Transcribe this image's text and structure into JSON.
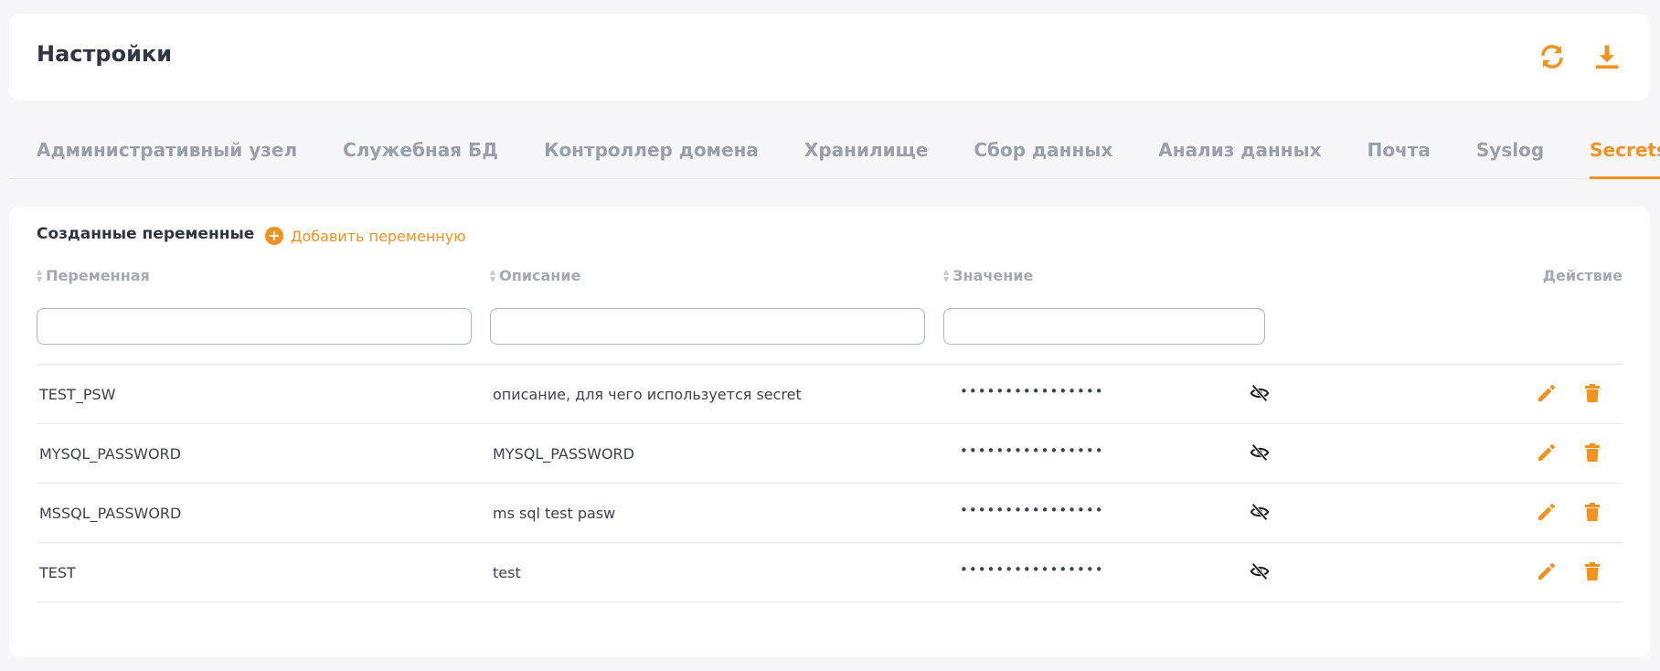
{
  "header": {
    "title": "Настройки",
    "refresh_icon": "refresh-icon",
    "download_icon": "download-icon",
    "accent_color": "#f29220"
  },
  "tabs": [
    {
      "label": "Административный узел",
      "active": false
    },
    {
      "label": "Служебная БД",
      "active": false
    },
    {
      "label": "Контроллер домена",
      "active": false
    },
    {
      "label": "Хранилище",
      "active": false
    },
    {
      "label": "Сбор данных",
      "active": false
    },
    {
      "label": "Анализ данных",
      "active": false
    },
    {
      "label": "Почта",
      "active": false
    },
    {
      "label": "Syslog",
      "active": false
    },
    {
      "label": "Secrets",
      "active": true
    }
  ],
  "section": {
    "title": "Созданные переменные",
    "add_label": "Добавить переменную"
  },
  "columns": {
    "variable": "Переменная",
    "description": "Описание",
    "value": "Значение",
    "action": "Действие"
  },
  "filters": {
    "variable": "",
    "description": "",
    "value": ""
  },
  "rows": [
    {
      "variable": "TEST_PSW",
      "description": "описание, для чего используется secret",
      "value": "••••••••••••••••"
    },
    {
      "variable": "MYSQL_PASSWORD",
      "description": "MYSQL_PASSWORD",
      "value": "••••••••••••••••"
    },
    {
      "variable": "MSSQL_PASSWORD",
      "description": "ms sql test pasw",
      "value": "••••••••••••••••"
    },
    {
      "variable": "TEST",
      "description": "test",
      "value": "••••••••••••••••"
    }
  ]
}
